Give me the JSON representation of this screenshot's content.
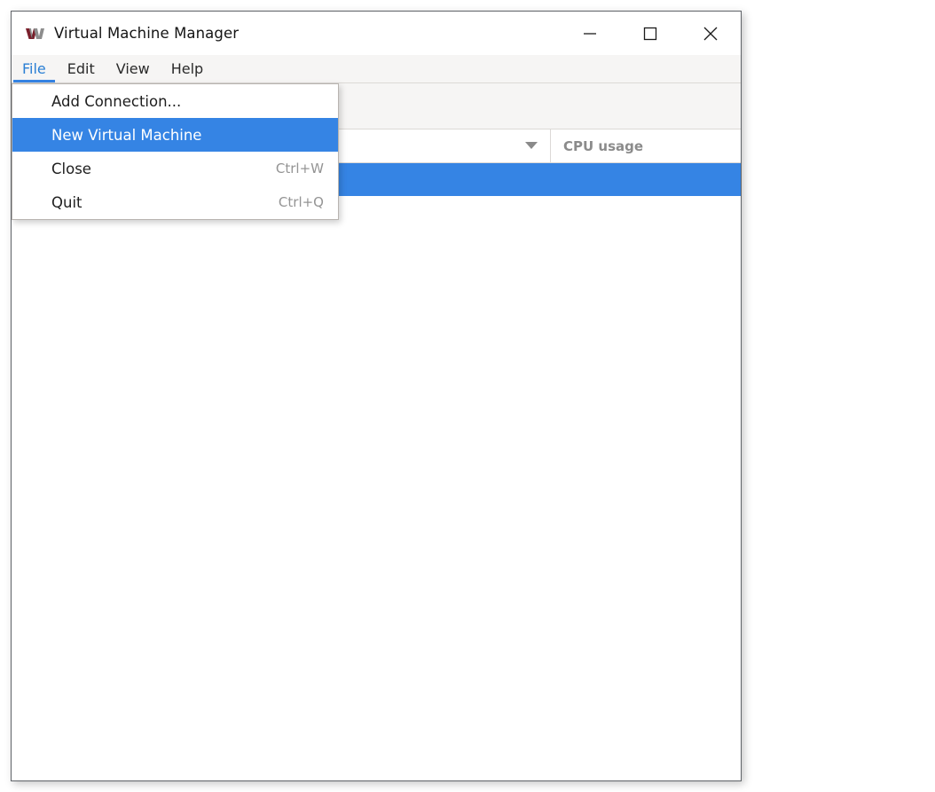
{
  "window": {
    "title": "Virtual Machine Manager",
    "icon": "virt-manager-icon",
    "controls": {
      "minimize": "minimize-icon",
      "maximize": "maximize-icon",
      "close": "close-icon"
    }
  },
  "menubar": {
    "items": [
      {
        "label": "File",
        "active": true
      },
      {
        "label": "Edit",
        "active": false
      },
      {
        "label": "View",
        "active": false
      },
      {
        "label": "Help",
        "active": false
      }
    ]
  },
  "toolbar": {
    "power_button": "power-icon",
    "power_menu_arrow": "chevron-down-icon"
  },
  "vm_list": {
    "columns": [
      {
        "label": "",
        "sort_indicator": "chevron-down-icon"
      },
      {
        "label": "CPU usage"
      }
    ],
    "rows": [
      {
        "name": "",
        "cpu_usage": "",
        "selected": true
      }
    ]
  },
  "file_menu": {
    "items": [
      {
        "label": "Add Connection...",
        "accel": "",
        "highlighted": false
      },
      {
        "label": "New Virtual Machine",
        "accel": "",
        "highlighted": true
      },
      {
        "label": "Close",
        "accel": "Ctrl+W",
        "highlighted": false
      },
      {
        "label": "Quit",
        "accel": "Ctrl+Q",
        "highlighted": false
      }
    ]
  },
  "colors": {
    "accent": "#3584e4",
    "menubar_bg": "#f6f5f4",
    "window_border": "#5f6368",
    "header_text": "#8b8b8b",
    "accel_text": "#949494"
  }
}
